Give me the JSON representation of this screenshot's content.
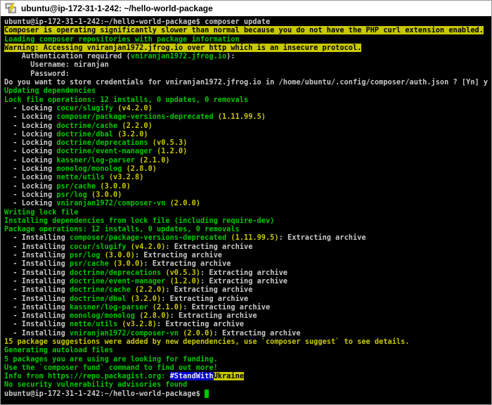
{
  "window": {
    "title": "ubuntu@ip-172-31-1-242: ~/hello-world-package",
    "icon": "putty-terminal-icon"
  },
  "colors": {
    "window_border": "#9b9b9b",
    "titlebar_bg": "#ffffff",
    "titlebar_fg": "#000000",
    "terminal_bg": "#000000",
    "default_fg": "#c8c8c8",
    "green": "#00c800",
    "yellow": "#c8c800",
    "warning_bg": "#c8c800",
    "warning_fg": "#000000",
    "stand_with_bg": "#0000c8",
    "stand_with_fg": "#e8e8e8",
    "ukraine_bg": "#c8c800",
    "ukraine_fg": "#000000",
    "cursor": "#00c800"
  },
  "terminal": {
    "lines": [
      {
        "segments": [
          {
            "t": "ubuntu@ip-172-31-1-242:~/hello-world-package$ composer update",
            "c": "default"
          }
        ]
      },
      {
        "segments": [
          {
            "t": "Composer is operating significantly slower than normal because you do not have the PHP curl extension enabled.",
            "c": "warnbg"
          }
        ]
      },
      {
        "segments": [
          {
            "t": "Loading composer repositories with package information",
            "c": "green"
          }
        ]
      },
      {
        "segments": [
          {
            "t": "Warning: Accessing vniranjan1972.jfrog.io over http which is an insecure protocol.",
            "c": "warnbg"
          }
        ]
      },
      {
        "segments": [
          {
            "t": "    Authentication required (",
            "c": "default"
          },
          {
            "t": "vniranjan1972.jfrog.io",
            "c": "green"
          },
          {
            "t": "):",
            "c": "default"
          }
        ]
      },
      {
        "segments": [
          {
            "t": "      Username: niranjan",
            "c": "default"
          }
        ]
      },
      {
        "segments": [
          {
            "t": "      Password:",
            "c": "default"
          }
        ]
      },
      {
        "segments": [
          {
            "t": "Do you want to store credentials for vniranjan1972.jfrog.io in /home/ubuntu/.config/composer/auth.json ? [Yn] y",
            "c": "default"
          }
        ]
      },
      {
        "segments": [
          {
            "t": "Updating dependencies",
            "c": "green"
          }
        ]
      },
      {
        "segments": [
          {
            "t": "Lock file operations: 12 installs, 0 updates, 0 removals",
            "c": "green"
          }
        ]
      },
      {
        "segments": [
          {
            "t": "  - Locking ",
            "c": "default"
          },
          {
            "t": "cocur/slugify",
            "c": "green"
          },
          {
            "t": " ",
            "c": "default"
          },
          {
            "t": "(v4.2.0)",
            "c": "yellow"
          }
        ]
      },
      {
        "segments": [
          {
            "t": "  - Locking ",
            "c": "default"
          },
          {
            "t": "composer/package-versions-deprecated",
            "c": "green"
          },
          {
            "t": " ",
            "c": "default"
          },
          {
            "t": "(1.11.99.5)",
            "c": "yellow"
          }
        ]
      },
      {
        "segments": [
          {
            "t": "  - Locking ",
            "c": "default"
          },
          {
            "t": "doctrine/cache",
            "c": "green"
          },
          {
            "t": " ",
            "c": "default"
          },
          {
            "t": "(2.2.0)",
            "c": "yellow"
          }
        ]
      },
      {
        "segments": [
          {
            "t": "  - Locking ",
            "c": "default"
          },
          {
            "t": "doctrine/dbal",
            "c": "green"
          },
          {
            "t": " ",
            "c": "default"
          },
          {
            "t": "(3.2.0)",
            "c": "yellow"
          }
        ]
      },
      {
        "segments": [
          {
            "t": "  - Locking ",
            "c": "default"
          },
          {
            "t": "doctrine/deprecations",
            "c": "green"
          },
          {
            "t": " ",
            "c": "default"
          },
          {
            "t": "(v0.5.3)",
            "c": "yellow"
          }
        ]
      },
      {
        "segments": [
          {
            "t": "  - Locking ",
            "c": "default"
          },
          {
            "t": "doctrine/event-manager",
            "c": "green"
          },
          {
            "t": " ",
            "c": "default"
          },
          {
            "t": "(1.2.0)",
            "c": "yellow"
          }
        ]
      },
      {
        "segments": [
          {
            "t": "  - Locking ",
            "c": "default"
          },
          {
            "t": "kassner/log-parser",
            "c": "green"
          },
          {
            "t": " ",
            "c": "default"
          },
          {
            "t": "(2.1.0)",
            "c": "yellow"
          }
        ]
      },
      {
        "segments": [
          {
            "t": "  - Locking ",
            "c": "default"
          },
          {
            "t": "monolog/monolog",
            "c": "green"
          },
          {
            "t": " ",
            "c": "default"
          },
          {
            "t": "(2.8.0)",
            "c": "yellow"
          }
        ]
      },
      {
        "segments": [
          {
            "t": "  - Locking ",
            "c": "default"
          },
          {
            "t": "nette/utils",
            "c": "green"
          },
          {
            "t": " ",
            "c": "default"
          },
          {
            "t": "(v3.2.8)",
            "c": "yellow"
          }
        ]
      },
      {
        "segments": [
          {
            "t": "  - Locking ",
            "c": "default"
          },
          {
            "t": "psr/cache",
            "c": "green"
          },
          {
            "t": " ",
            "c": "default"
          },
          {
            "t": "(3.0.0)",
            "c": "yellow"
          }
        ]
      },
      {
        "segments": [
          {
            "t": "  - Locking ",
            "c": "default"
          },
          {
            "t": "psr/log",
            "c": "green"
          },
          {
            "t": " ",
            "c": "default"
          },
          {
            "t": "(3.0.0)",
            "c": "yellow"
          }
        ]
      },
      {
        "segments": [
          {
            "t": "  - Locking ",
            "c": "default"
          },
          {
            "t": "vniranjan1972/composer-vn",
            "c": "green"
          },
          {
            "t": " ",
            "c": "default"
          },
          {
            "t": "(2.0.0)",
            "c": "yellow"
          }
        ]
      },
      {
        "segments": [
          {
            "t": "Writing lock file",
            "c": "green"
          }
        ]
      },
      {
        "segments": [
          {
            "t": "Installing dependencies from lock file (including require-dev)",
            "c": "green"
          }
        ]
      },
      {
        "segments": [
          {
            "t": "Package operations: 12 installs, 0 updates, 0 removals",
            "c": "green"
          }
        ]
      },
      {
        "segments": [
          {
            "t": "  - Installing ",
            "c": "default"
          },
          {
            "t": "composer/package-versions-deprecated",
            "c": "green"
          },
          {
            "t": " ",
            "c": "default"
          },
          {
            "t": "(1.11.99.5)",
            "c": "yellow"
          },
          {
            "t": ": Extracting archive",
            "c": "default"
          }
        ]
      },
      {
        "segments": [
          {
            "t": "  - Installing ",
            "c": "default"
          },
          {
            "t": "cocur/slugify",
            "c": "green"
          },
          {
            "t": " ",
            "c": "default"
          },
          {
            "t": "(v4.2.0)",
            "c": "yellow"
          },
          {
            "t": ": Extracting archive",
            "c": "default"
          }
        ]
      },
      {
        "segments": [
          {
            "t": "  - Installing ",
            "c": "default"
          },
          {
            "t": "psr/log",
            "c": "green"
          },
          {
            "t": " ",
            "c": "default"
          },
          {
            "t": "(3.0.0)",
            "c": "yellow"
          },
          {
            "t": ": Extracting archive",
            "c": "default"
          }
        ]
      },
      {
        "segments": [
          {
            "t": "  - Installing ",
            "c": "default"
          },
          {
            "t": "psr/cache",
            "c": "green"
          },
          {
            "t": " ",
            "c": "default"
          },
          {
            "t": "(3.0.0)",
            "c": "yellow"
          },
          {
            "t": ": Extracting archive",
            "c": "default"
          }
        ]
      },
      {
        "segments": [
          {
            "t": "  - Installing ",
            "c": "default"
          },
          {
            "t": "doctrine/deprecations",
            "c": "green"
          },
          {
            "t": " ",
            "c": "default"
          },
          {
            "t": "(v0.5.3)",
            "c": "yellow"
          },
          {
            "t": ": Extracting archive",
            "c": "default"
          }
        ]
      },
      {
        "segments": [
          {
            "t": "  - Installing ",
            "c": "default"
          },
          {
            "t": "doctrine/event-manager",
            "c": "green"
          },
          {
            "t": " ",
            "c": "default"
          },
          {
            "t": "(1.2.0)",
            "c": "yellow"
          },
          {
            "t": ": Extracting archive",
            "c": "default"
          }
        ]
      },
      {
        "segments": [
          {
            "t": "  - Installing ",
            "c": "default"
          },
          {
            "t": "doctrine/cache",
            "c": "green"
          },
          {
            "t": " ",
            "c": "default"
          },
          {
            "t": "(2.2.0)",
            "c": "yellow"
          },
          {
            "t": ": Extracting archive",
            "c": "default"
          }
        ]
      },
      {
        "segments": [
          {
            "t": "  - Installing ",
            "c": "default"
          },
          {
            "t": "doctrine/dbal",
            "c": "green"
          },
          {
            "t": " ",
            "c": "default"
          },
          {
            "t": "(3.2.0)",
            "c": "yellow"
          },
          {
            "t": ": Extracting archive",
            "c": "default"
          }
        ]
      },
      {
        "segments": [
          {
            "t": "  - Installing ",
            "c": "default"
          },
          {
            "t": "kassner/log-parser",
            "c": "green"
          },
          {
            "t": " ",
            "c": "default"
          },
          {
            "t": "(2.1.0)",
            "c": "yellow"
          },
          {
            "t": ": Extracting archive",
            "c": "default"
          }
        ]
      },
      {
        "segments": [
          {
            "t": "  - Installing ",
            "c": "default"
          },
          {
            "t": "monolog/monolog",
            "c": "green"
          },
          {
            "t": " ",
            "c": "default"
          },
          {
            "t": "(2.8.0)",
            "c": "yellow"
          },
          {
            "t": ": Extracting archive",
            "c": "default"
          }
        ]
      },
      {
        "segments": [
          {
            "t": "  - Installing ",
            "c": "default"
          },
          {
            "t": "nette/utils",
            "c": "green"
          },
          {
            "t": " ",
            "c": "default"
          },
          {
            "t": "(v3.2.8)",
            "c": "yellow"
          },
          {
            "t": ": Extracting archive",
            "c": "default"
          }
        ]
      },
      {
        "segments": [
          {
            "t": "  - Installing ",
            "c": "default"
          },
          {
            "t": "vniranjan1972/composer-vn",
            "c": "green"
          },
          {
            "t": " ",
            "c": "default"
          },
          {
            "t": "(2.0.0)",
            "c": "yellow"
          },
          {
            "t": ": Extracting archive",
            "c": "default"
          }
        ]
      },
      {
        "segments": [
          {
            "t": "15 package suggestions were added by new dependencies, use `composer suggest` to see details.",
            "c": "yellow"
          }
        ]
      },
      {
        "segments": [
          {
            "t": "Generating autoload files",
            "c": "green"
          }
        ]
      },
      {
        "segments": [
          {
            "t": "5 packages you are using are looking for funding.",
            "c": "green"
          }
        ]
      },
      {
        "segments": [
          {
            "t": "Use the `composer fund` command to find out more!",
            "c": "green"
          }
        ]
      },
      {
        "segments": [
          {
            "t": "Info from https://repo.packagist.org: ",
            "c": "green"
          },
          {
            "t": "#StandWith",
            "c": "bluebg"
          },
          {
            "t": "Ukraine",
            "c": "ukrainebg"
          }
        ]
      },
      {
        "segments": [
          {
            "t": "No security vulnerability advisories found",
            "c": "green"
          }
        ]
      },
      {
        "segments": [
          {
            "t": "ubuntu@ip-172-31-1-242:~/hello-world-package$ ",
            "c": "default"
          },
          {
            "t": " ",
            "c": "cursor"
          }
        ]
      }
    ]
  }
}
